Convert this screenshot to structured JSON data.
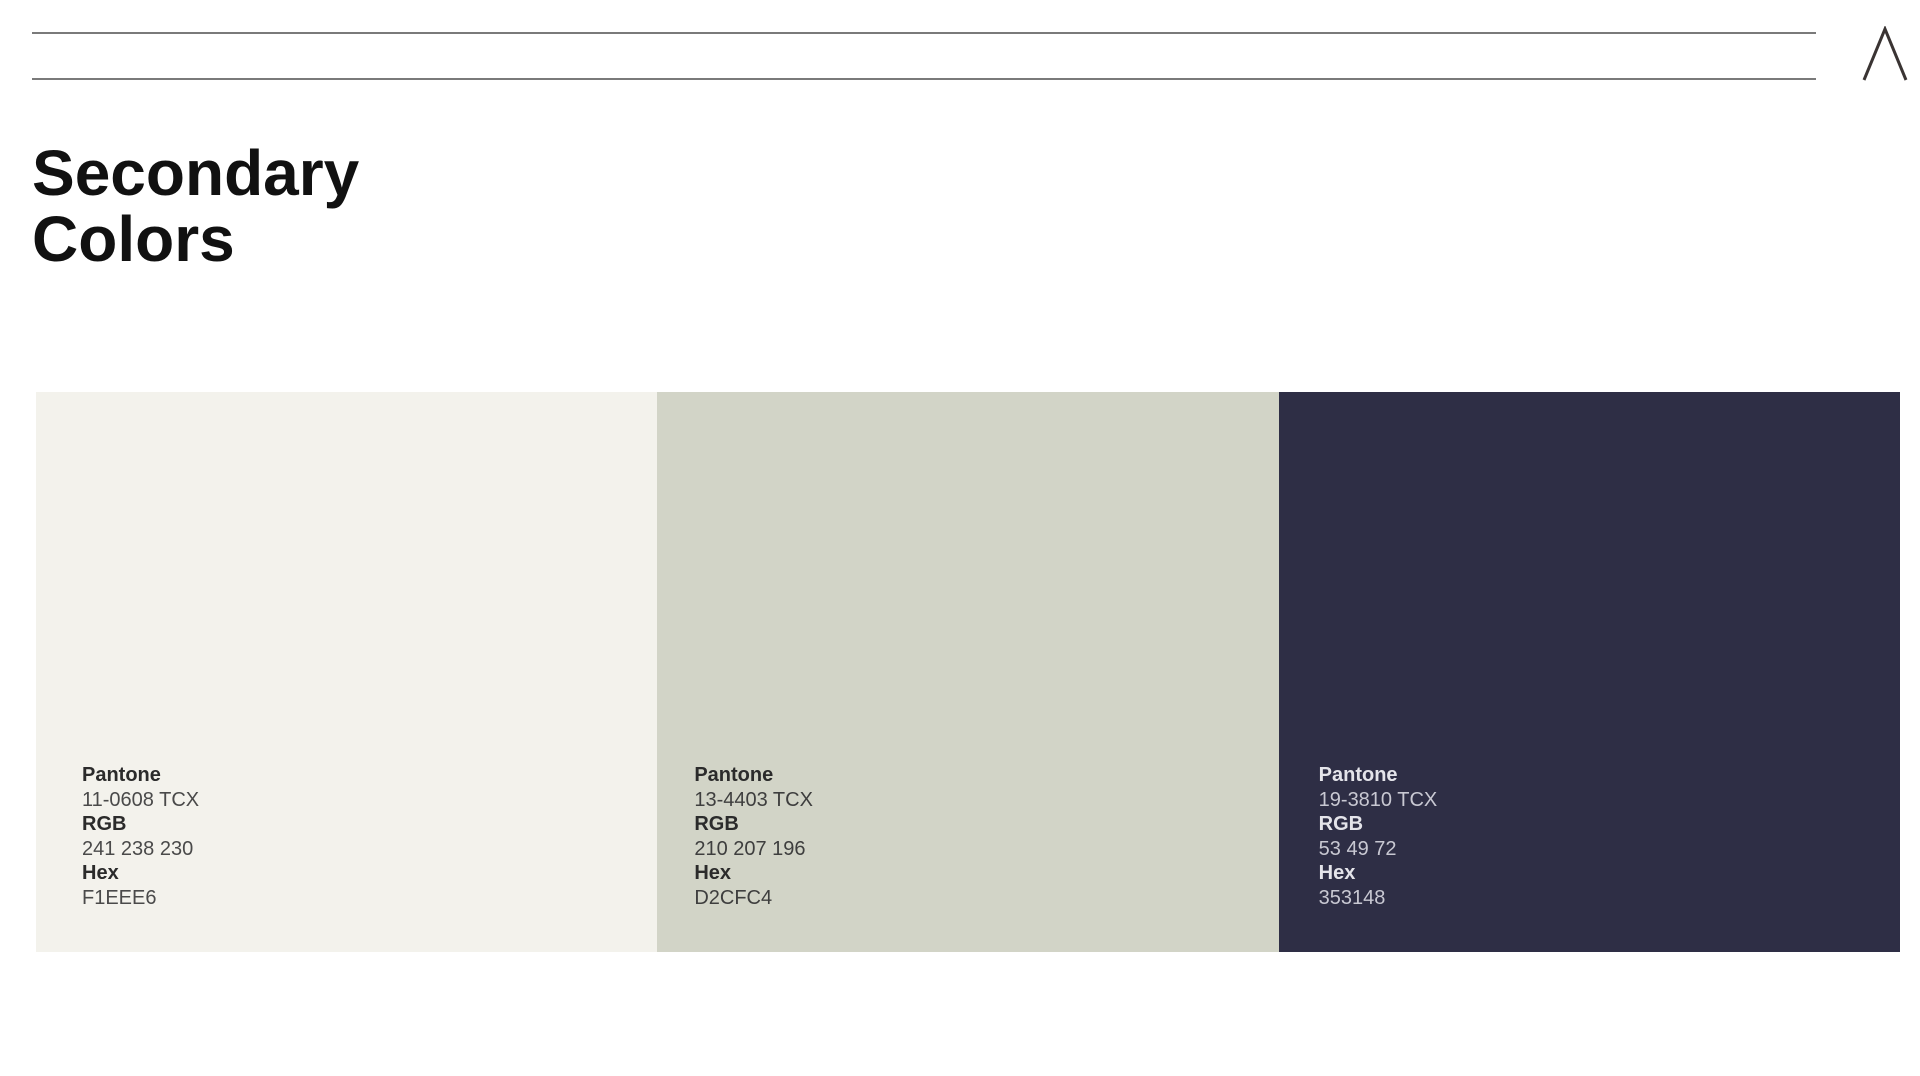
{
  "header": {
    "logo_icon": "lambda-logo-icon"
  },
  "title": {
    "line1": "Secondary",
    "line2": "Colors"
  },
  "swatches": [
    {
      "color": "#F1EEE6",
      "pantone_label": "Pantone",
      "pantone_value": "11-0608 TCX",
      "rgb_label": "RGB",
      "rgb_value": "241 238 230",
      "hex_label": "Hex",
      "hex_value": "F1EEE6"
    },
    {
      "color": "#D2CFC4",
      "pantone_label": "Pantone",
      "pantone_value": "13-4403 TCX",
      "rgb_label": "RGB",
      "rgb_value": "210 207 196",
      "hex_label": "Hex",
      "hex_value": "D2CFC4"
    },
    {
      "color": "#353148",
      "pantone_label": "Pantone",
      "pantone_value": "19-3810 TCX",
      "rgb_label": "RGB",
      "rgb_value": "53 49 72",
      "hex_label": "Hex",
      "hex_value": "353148"
    }
  ]
}
